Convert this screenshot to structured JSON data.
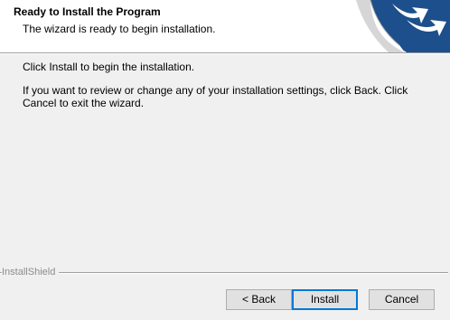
{
  "header": {
    "title": "Ready to Install the Program",
    "subtitle": "The wizard is ready to begin installation."
  },
  "body": {
    "line1": "Click Install to begin the installation.",
    "line2": "If you want to review or change any of your installation settings, click Back. Click Cancel to exit the wizard."
  },
  "footer": {
    "brand": "InstallShield"
  },
  "buttons": {
    "back": "< Back",
    "install": "Install",
    "cancel": "Cancel"
  },
  "colors": {
    "focus_border": "#0078d7",
    "graphic_blue": "#1c4f8c"
  },
  "icons": {
    "header_graphic": "installshield-arrow-graphic"
  }
}
